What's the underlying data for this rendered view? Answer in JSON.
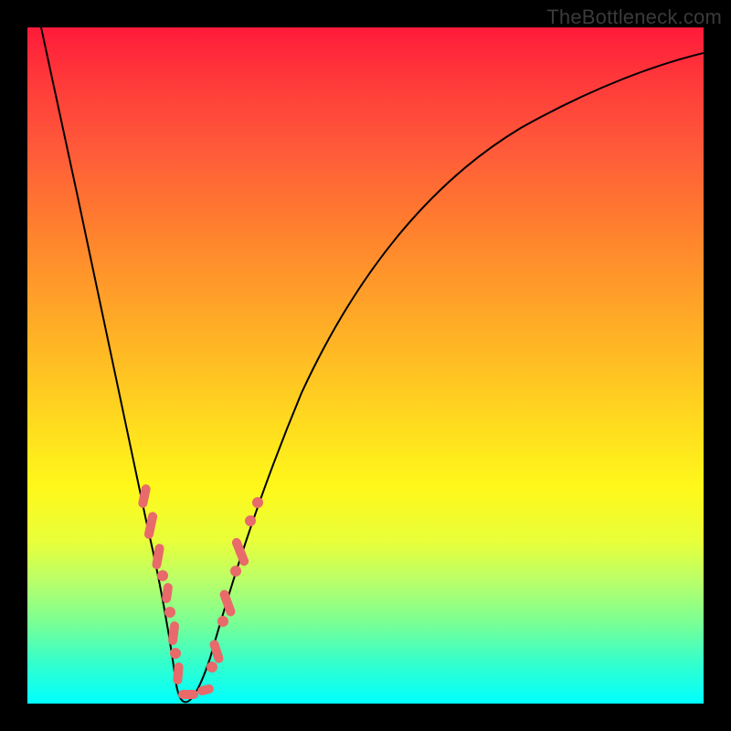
{
  "watermark": "TheBottleneck.com",
  "colors": {
    "dot_fill": "#e86a6a",
    "curve_stroke": "#000000"
  },
  "chart_data": {
    "type": "line",
    "title": "",
    "xlabel": "",
    "ylabel": "",
    "xlim": [
      0,
      100
    ],
    "ylim": [
      0,
      100
    ],
    "grid": false,
    "legend": false,
    "note": "Bottleneck percentage curve; y is bottleneck % (0 at optimal point near x≈22, rising toward 100 at extremes). Values estimated from pixel heights.",
    "series": [
      {
        "name": "bottleneck_pct",
        "x": [
          0,
          3,
          6,
          9,
          12,
          15,
          17,
          19,
          20,
          21,
          22,
          23,
          24,
          26,
          28,
          30,
          35,
          40,
          50,
          60,
          70,
          80,
          90,
          100
        ],
        "y": [
          100,
          90,
          79,
          67,
          54,
          40,
          28,
          15,
          8,
          3,
          0,
          2,
          5,
          12,
          20,
          28,
          43,
          54,
          68,
          76,
          81,
          84,
          86,
          88
        ]
      }
    ],
    "markers": {
      "note": "Pink dots/pills overlaid on the curve near the valley region",
      "points_x": [
        16.5,
        17.2,
        18.0,
        18.8,
        19.6,
        20.3,
        21.0,
        21.8,
        22.5,
        23.3,
        24.0,
        24.8,
        25.6,
        26.4,
        27.2,
        28.0,
        29.0,
        30.0
      ]
    }
  }
}
